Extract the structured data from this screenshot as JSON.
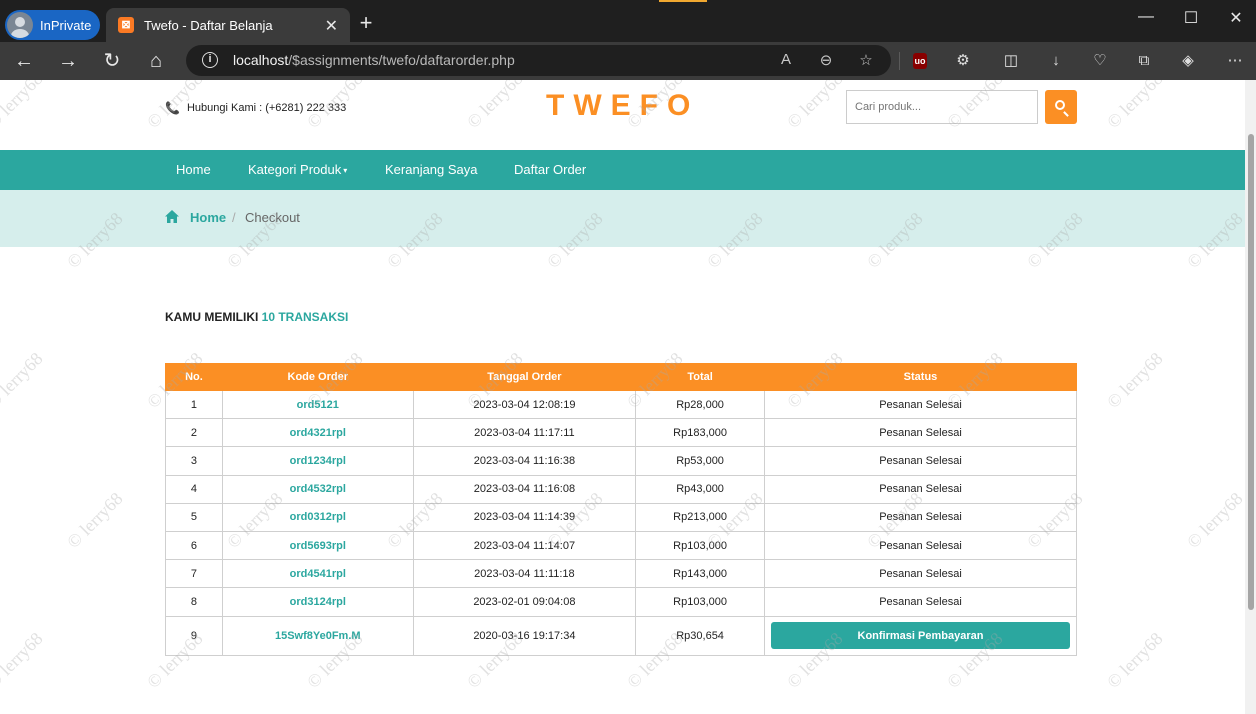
{
  "browser": {
    "inprivate_label": "InPrivate",
    "tab_title": "Twefo - Daftar Belanja",
    "url_host": "localhost",
    "url_path": "/$assignments/twefo/daftarorder.php"
  },
  "header": {
    "contact": "Hubungi Kami : (+6281) 222 333",
    "logo": "TWEFO",
    "search_placeholder": "Cari produk..."
  },
  "nav": {
    "items": [
      "Home",
      "Kategori Produk",
      "Keranjang Saya",
      "Daftar Order"
    ]
  },
  "breadcrumb": {
    "home": "Home",
    "separator": "/",
    "current": "Checkout"
  },
  "summary": {
    "prefix": "KAMU MEMILIKI",
    "count": "10 TRANSAKSI"
  },
  "orders": {
    "columns": [
      "No.",
      "Kode Order",
      "Tanggal Order",
      "Total",
      "Status"
    ],
    "rows": [
      {
        "no": "1",
        "code": "ord5121",
        "date": "2023-03-04 12:08:19",
        "total": "Rp28,000",
        "status": "Pesanan Selesai"
      },
      {
        "no": "2",
        "code": "ord4321rpl",
        "date": "2023-03-04 11:17:11",
        "total": "Rp183,000",
        "status": "Pesanan Selesai"
      },
      {
        "no": "3",
        "code": "ord1234rpl",
        "date": "2023-03-04 11:16:38",
        "total": "Rp53,000",
        "status": "Pesanan Selesai"
      },
      {
        "no": "4",
        "code": "ord4532rpl",
        "date": "2023-03-04 11:16:08",
        "total": "Rp43,000",
        "status": "Pesanan Selesai"
      },
      {
        "no": "5",
        "code": "ord0312rpl",
        "date": "2023-03-04 11:14:39",
        "total": "Rp213,000",
        "status": "Pesanan Selesai"
      },
      {
        "no": "6",
        "code": "ord5693rpl",
        "date": "2023-03-04 11:14:07",
        "total": "Rp103,000",
        "status": "Pesanan Selesai"
      },
      {
        "no": "7",
        "code": "ord4541rpl",
        "date": "2023-03-04 11:11:18",
        "total": "Rp143,000",
        "status": "Pesanan Selesai"
      },
      {
        "no": "8",
        "code": "ord3124rpl",
        "date": "2023-02-01 09:04:08",
        "total": "Rp103,000",
        "status": "Pesanan Selesai"
      }
    ],
    "last_row": {
      "no": "9",
      "code": "15Swf8Ye0Fm.M",
      "date": "2020-03-16 19:17:34",
      "total": "Rp30,654",
      "action": "Konfirmasi Pembayaran"
    }
  },
  "watermark_text": "© lerry68",
  "colors": {
    "brand_orange": "#fb8f24",
    "brand_teal": "#2ba79f",
    "breadcrumb_bg": "#d6eeec"
  }
}
